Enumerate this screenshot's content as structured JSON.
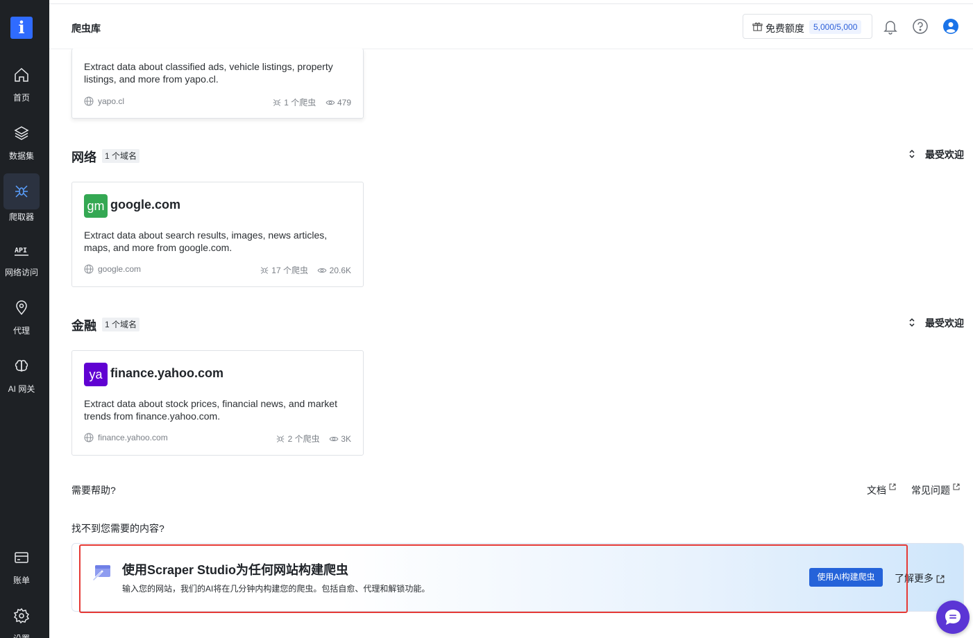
{
  "sidebar": {
    "logo": "i",
    "items": [
      {
        "label": "首页",
        "icon": "home-icon"
      },
      {
        "label": "数据集",
        "icon": "layers-icon"
      },
      {
        "label": "爬取器",
        "icon": "spider-icon",
        "active": true
      },
      {
        "label": "网络访问",
        "icon": "api-icon"
      },
      {
        "label": "代理",
        "icon": "location-pin-icon"
      },
      {
        "label": "AI 网关",
        "icon": "brain-icon"
      },
      {
        "label": "账单",
        "icon": "billing-card-icon"
      },
      {
        "label": "设置",
        "icon": "gear-icon"
      }
    ]
  },
  "header": {
    "title": "爬虫库",
    "quota_label": "免费额度",
    "quota_value": "5,000/5,000"
  },
  "top_card": {
    "description": "Extract data about classified ads, vehicle listings, property listings, and more from yapo.cl.",
    "host": "yapo.cl",
    "scrapers": "1 个爬虫",
    "views": "479"
  },
  "sections": [
    {
      "title": "网络",
      "badge": "1 个域名",
      "sort": "最受欢迎",
      "card": {
        "favicon": "gm",
        "favicon_color": "#34a853",
        "domain": "google.com",
        "description": "Extract data about search results, images, news articles, maps, and more from google.com.",
        "host": "google.com",
        "scrapers": "17 个爬虫",
        "views": "20.6K"
      }
    },
    {
      "title": "金融",
      "badge": "1 个域名",
      "sort": "最受欢迎",
      "card": {
        "favicon": "ya",
        "favicon_color": "#6001d2",
        "domain": "finance.yahoo.com",
        "description": "Extract data about stock prices, financial news, and market trends from finance.yahoo.com.",
        "host": "finance.yahoo.com",
        "scrapers": "2 个爬虫",
        "views": "3K"
      }
    }
  ],
  "help": {
    "label": "需要帮助?",
    "docs": "文档",
    "faq": "常见问题"
  },
  "not_found": "找不到您需要的内容?",
  "banner": {
    "title": "使用Scraper Studio为任何网站构建爬虫",
    "subtitle": "输入您的网站，我们的AI将在几分钟内构建您的爬虫。包括自愈、代理和解锁功能。",
    "button": "使用AI构建爬虫",
    "learn_more": "了解更多"
  },
  "colors": {
    "sidebar_bg": "#1e2125",
    "accent": "#2563d9",
    "highlight_box": "#e53935",
    "chat": "#5b35d5"
  }
}
